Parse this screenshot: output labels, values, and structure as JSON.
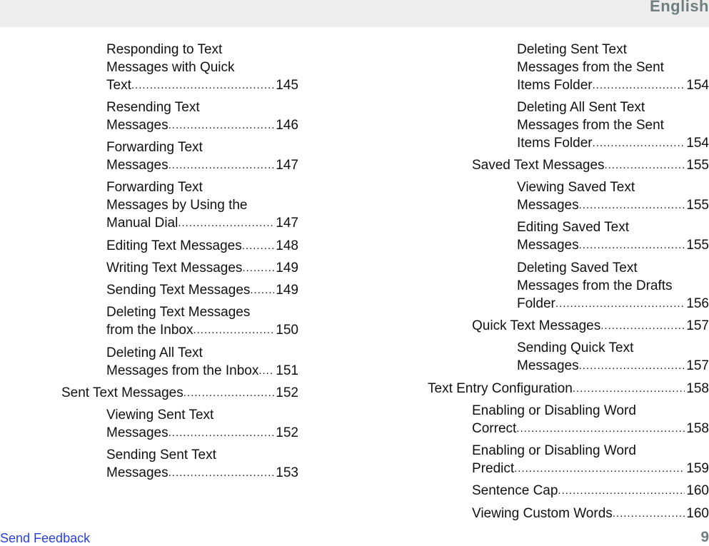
{
  "header": {
    "language": "English"
  },
  "left_column": [
    {
      "level": 2,
      "lines": [
        "Responding to Text",
        "Messages with Quick",
        "Text"
      ],
      "page": "145"
    },
    {
      "level": 2,
      "lines": [
        "Resending Text",
        "Messages "
      ],
      "page": "146"
    },
    {
      "level": 2,
      "lines": [
        "Forwarding Text",
        "Messages"
      ],
      "page": "147"
    },
    {
      "level": 2,
      "lines": [
        "Forwarding Text",
        "Messages by Using the",
        "Manual Dial"
      ],
      "page": "147"
    },
    {
      "level": 2,
      "lines": [
        "Editing Text Messages"
      ],
      "page": "148"
    },
    {
      "level": 2,
      "lines": [
        "Writing Text Messages"
      ],
      "page": "149"
    },
    {
      "level": 2,
      "lines": [
        "Sending Text Messages"
      ],
      "page": "149"
    },
    {
      "level": 2,
      "lines": [
        "Deleting Text Messages",
        "from the Inbox"
      ],
      "page": "150"
    },
    {
      "level": 2,
      "lines": [
        "Deleting All Text",
        "Messages from the Inbox"
      ],
      "page": "151"
    },
    {
      "level": 1,
      "lines": [
        "Sent Text Messages"
      ],
      "page": "152"
    },
    {
      "level": 2,
      "lines": [
        "Viewing Sent Text",
        "Messages"
      ],
      "page": "152"
    },
    {
      "level": 2,
      "lines": [
        "Sending Sent Text",
        "Messages"
      ],
      "page": "153"
    }
  ],
  "right_column": [
    {
      "level": 3,
      "lines": [
        "Deleting Sent Text",
        "Messages from the Sent",
        "Items Folder"
      ],
      "page": "154"
    },
    {
      "level": 3,
      "lines": [
        "Deleting All Sent Text",
        "Messages from the Sent",
        "Items Folder "
      ],
      "page": "154"
    },
    {
      "level": 2,
      "lines": [
        "Saved Text Messages"
      ],
      "page": "155"
    },
    {
      "level": 3,
      "lines": [
        "Viewing Saved Text",
        "Messages"
      ],
      "page": "155"
    },
    {
      "level": 3,
      "lines": [
        "Editing Saved Text",
        "Messages"
      ],
      "page": "155"
    },
    {
      "level": 3,
      "lines": [
        "Deleting Saved Text",
        "Messages from the Drafts",
        "Folder"
      ],
      "page": "156"
    },
    {
      "level": 2,
      "lines": [
        "Quick Text Messages "
      ],
      "page": "157"
    },
    {
      "level": 3,
      "lines": [
        "Sending Quick Text",
        "Messages "
      ],
      "page": "157"
    },
    {
      "level": 1,
      "lines": [
        "Text Entry Configuration"
      ],
      "page": "158"
    },
    {
      "level": 2,
      "lines": [
        "Enabling or Disabling Word",
        "Correct"
      ],
      "page": "158"
    },
    {
      "level": 2,
      "lines": [
        "Enabling or Disabling Word",
        "Predict"
      ],
      "page": "159"
    },
    {
      "level": 2,
      "lines": [
        "Sentence Cap"
      ],
      "page": "160"
    },
    {
      "level": 2,
      "lines": [
        "Viewing Custom Words"
      ],
      "page": "160"
    }
  ],
  "footer": {
    "feedback_link": "Send Feedback",
    "page_number": "9"
  }
}
